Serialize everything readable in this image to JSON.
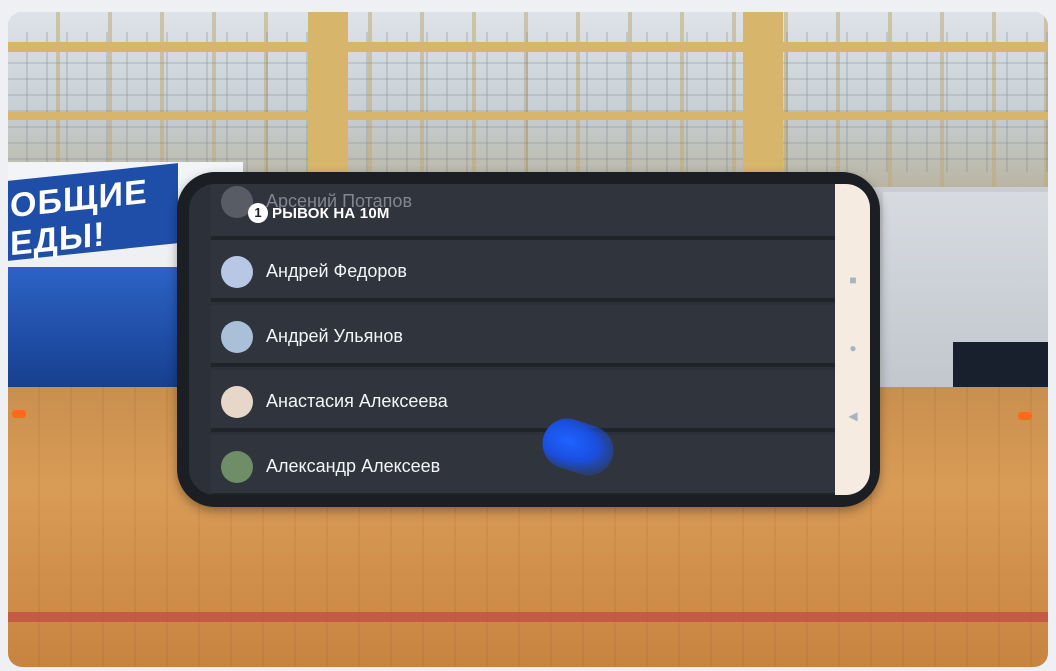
{
  "scene": {
    "banner_text": "ОБЩИЕ\nЕДЫ!"
  },
  "card": {
    "title_number": "1",
    "title_text": "РЫВОК НА 10М"
  },
  "athletes": [
    {
      "name": "Арсений Потапов",
      "avatar": "athlete-avatar"
    },
    {
      "name": "Андрей Федоров",
      "avatar": "athlete-avatar"
    },
    {
      "name": "Андрей Ульянов",
      "avatar": "athlete-avatar"
    },
    {
      "name": "Анастасия Алексеева",
      "avatar": "athlete-avatar"
    },
    {
      "name": "Александр Алексеев",
      "avatar": "athlete-avatar"
    }
  ],
  "navbar": {
    "recents_icon": "square-icon",
    "home_icon": "circle-icon",
    "back_icon": "triangle-back-icon"
  },
  "colors": {
    "accent_touch": "#1e63ff",
    "row_bg": "#30353d",
    "nav_bg": "#f6ebe1"
  }
}
